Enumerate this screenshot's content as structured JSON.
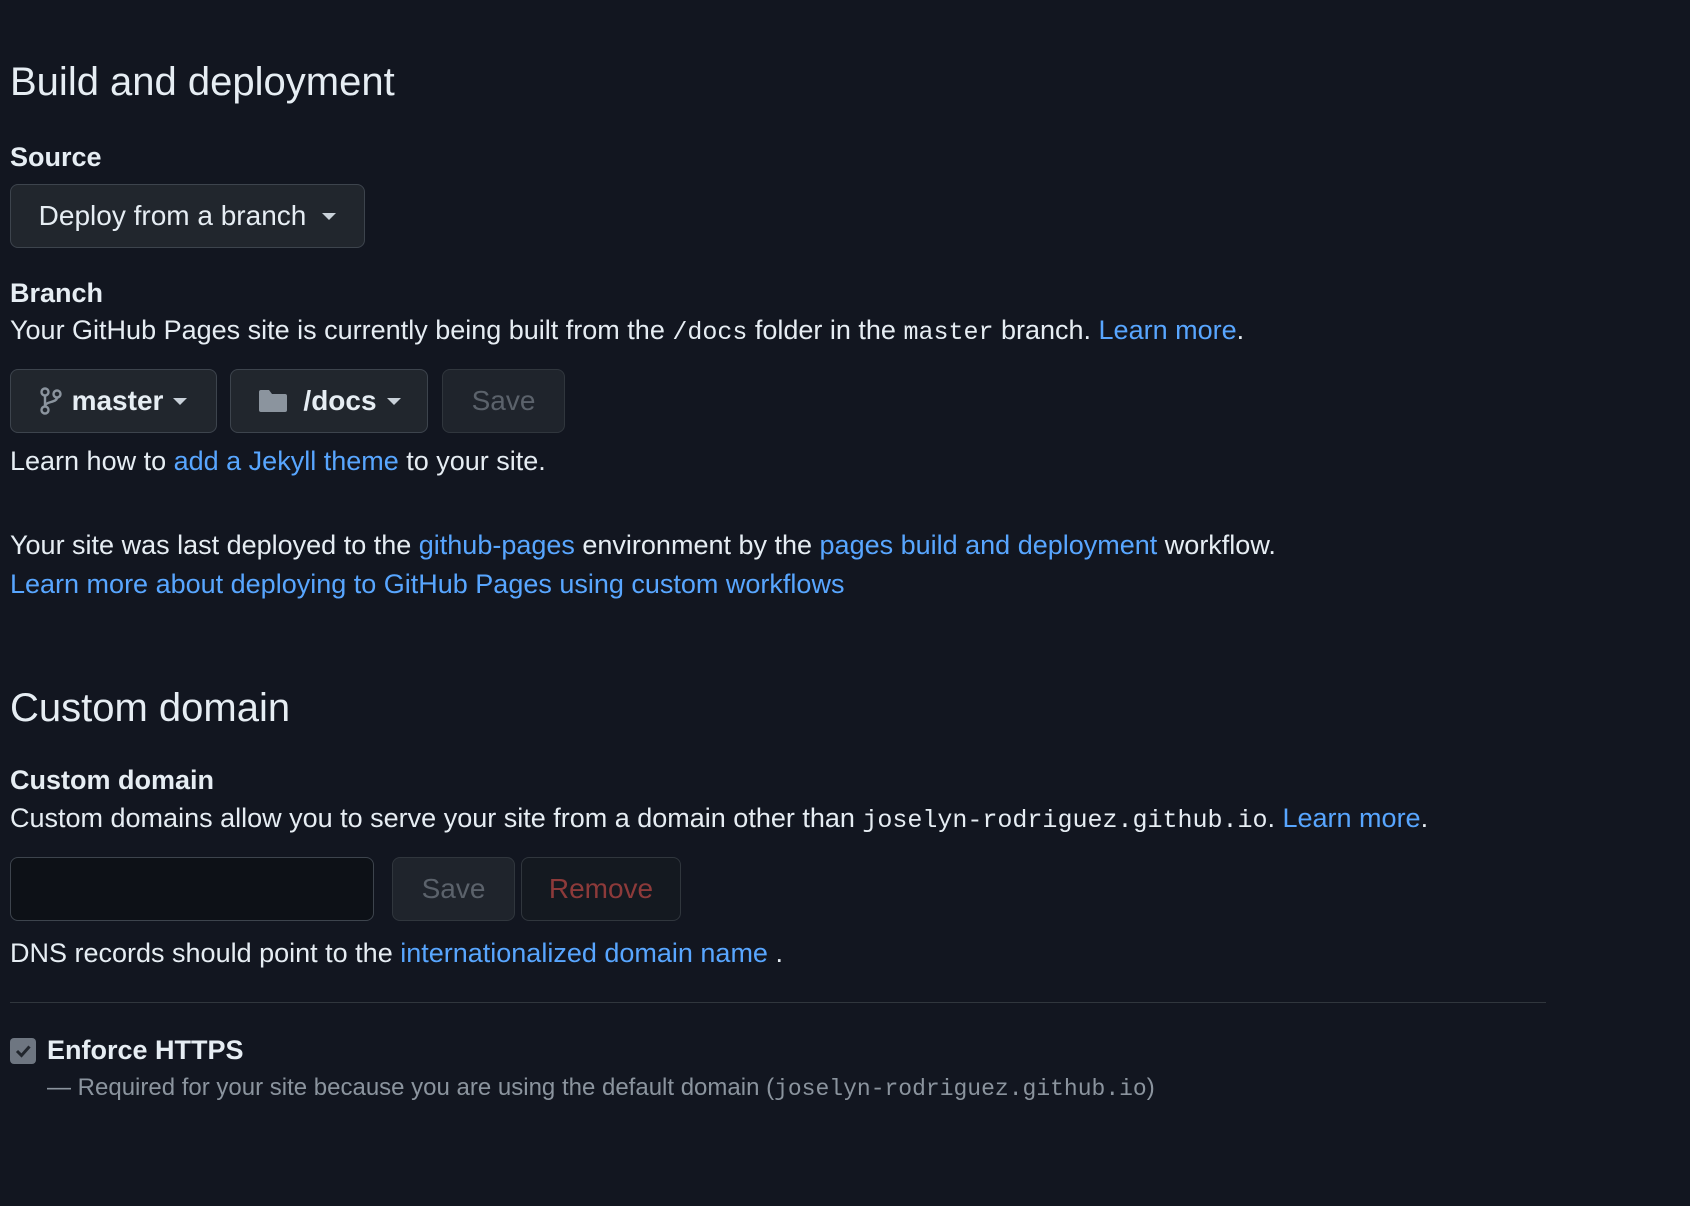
{
  "build": {
    "heading": "Build and deployment",
    "source_label": "Source",
    "source_value": "Deploy from a branch",
    "branch_label": "Branch",
    "branch_desc_pre": "Your GitHub Pages site is currently being built from the ",
    "branch_desc_folder": "/docs",
    "branch_desc_mid": " folder in the ",
    "branch_desc_branch": "master",
    "branch_desc_post": " branch. ",
    "branch_learn_more": "Learn more",
    "branch_desc_end": ".",
    "branch_select": "master",
    "folder_select": "/docs",
    "save_label": "Save",
    "jekyll_pre": "Learn how to ",
    "jekyll_link": "add a Jekyll theme",
    "jekyll_post": " to your site.",
    "deploy_pre": "Your site was last deployed to the ",
    "deploy_env_link": "github-pages",
    "deploy_mid": " environment by the ",
    "deploy_workflow_link": "pages build and deployment",
    "deploy_post": " workflow.",
    "custom_workflows_link": "Learn more about deploying to GitHub Pages using custom workflows"
  },
  "domain": {
    "heading": "Custom domain",
    "label": "Custom domain",
    "desc_pre": "Custom domains allow you to serve your site from a domain other than ",
    "desc_domain": "joselyn-rodriguez.github.io",
    "desc_mid": ". ",
    "learn_more": "Learn more",
    "desc_end": ".",
    "input_value": "",
    "save_label": "Save",
    "remove_label": "Remove",
    "dns_pre": "DNS records should point to the ",
    "dns_link": "internationalized domain name",
    "dns_post": " ."
  },
  "https": {
    "label": "Enforce HTTPS",
    "checked": true,
    "note_pre": "— Required for your site because you are using the default domain (",
    "note_domain": "joselyn-rodriguez.github.io",
    "note_post": ")"
  }
}
